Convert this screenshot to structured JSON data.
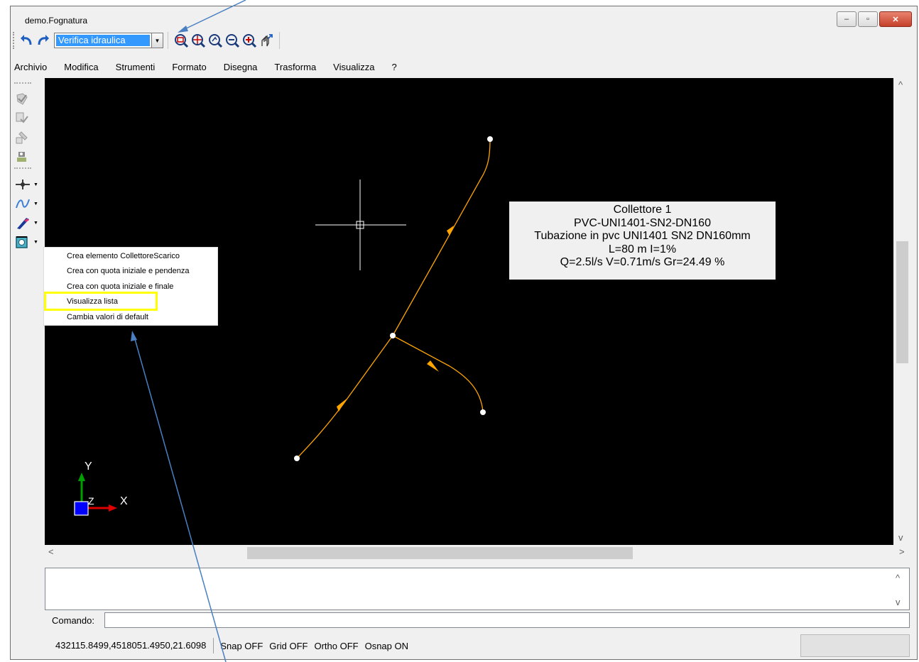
{
  "window": {
    "title": "demo.Fognatura",
    "controls": {
      "minimize": "–",
      "maximize": "▫",
      "close": "✕"
    }
  },
  "toolbar": {
    "mode_value": "Verifica idraulica",
    "icons": [
      "undo-icon",
      "redo-icon",
      "zoom-window-icon",
      "zoom-extents-icon",
      "zoom-previous-icon",
      "zoom-out-icon",
      "zoom-in-icon",
      "pan-icon"
    ]
  },
  "menu": [
    "Archivio",
    "Modifica",
    "Strumenti",
    "Formato",
    "Disegna",
    "Trasforma",
    "Visualizza",
    "?"
  ],
  "context_menu": {
    "items": [
      "Crea elemento CollettoreScarico",
      "Crea con quota iniziale e pendenza",
      "Crea con quota iniziale e finale",
      "Visualizza lista",
      "Cambia valori di default"
    ],
    "highlighted": "Visualizza lista"
  },
  "infobox": {
    "lines": [
      "Collettore 1",
      "PVC-UNI1401-SN2-DN160",
      "Tubazione in pvc UNI1401 SN2 DN160mm",
      "L=80 m I=1%",
      "Q=2.5l/s V=0.71m/s Gr=24.49 %"
    ]
  },
  "axes": {
    "x": "X",
    "y": "Y",
    "z": "Z"
  },
  "command": {
    "label": "Comando:",
    "value": ""
  },
  "status": {
    "coords": "432115.8499,4518051.4950,21.6098",
    "snap": "Snap OFF",
    "grid": "Grid OFF",
    "ortho": "Ortho OFF",
    "osnap": "Osnap ON"
  },
  "colors": {
    "pipe": "#ffa500",
    "canvas": "#000000",
    "highlight": "#ffff00",
    "annotation": "#4a7fc1",
    "selection": "#3399ff"
  }
}
